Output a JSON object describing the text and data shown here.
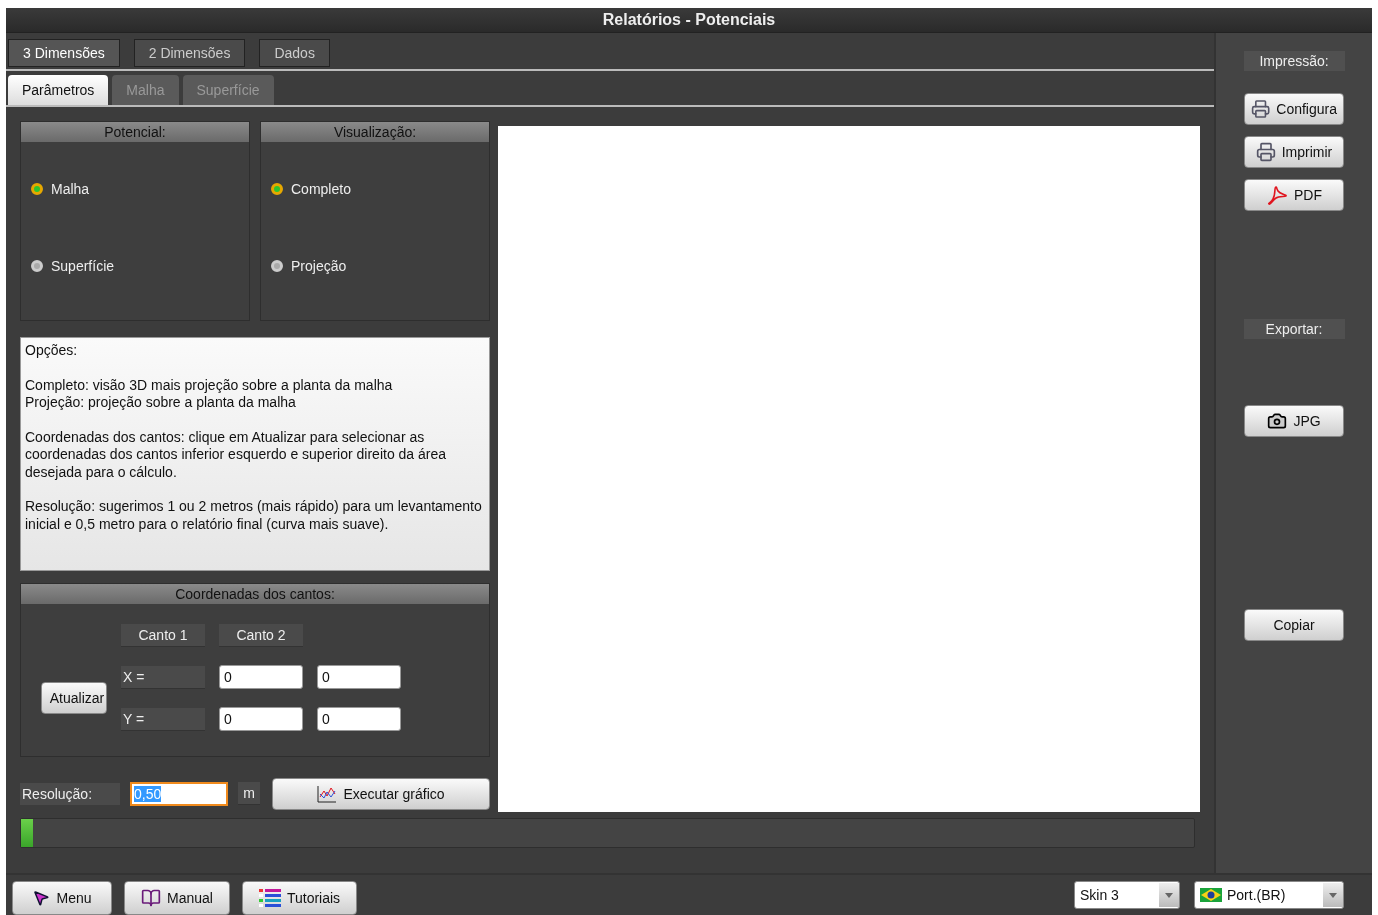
{
  "window": {
    "title": "Relatórios - Potenciais"
  },
  "main_tabs": [
    {
      "label": "3 Dimensões",
      "selected": true
    },
    {
      "label": "2 Dimensões",
      "selected": false
    },
    {
      "label": "Dados",
      "selected": false
    }
  ],
  "sub_tabs": [
    {
      "label": "Parâmetros",
      "selected": true
    },
    {
      "label": "Malha",
      "selected": false
    },
    {
      "label": "Superfície",
      "selected": false
    }
  ],
  "groups": [
    {
      "title": "Potencial:",
      "options": [
        {
          "label": "Malha",
          "selected": true
        },
        {
          "label": "Superfície",
          "selected": false
        }
      ]
    },
    {
      "title": "Visualização:",
      "options": [
        {
          "label": "Completo",
          "selected": true
        },
        {
          "label": "Projeção",
          "selected": false
        }
      ]
    }
  ],
  "options_panel": {
    "paragraphs": [
      [
        "Opções:"
      ],
      [
        "Completo: visão 3D mais projeção sobre a planta da malha",
        "Projeção: projeção sobre a planta da malha"
      ],
      [
        "Coordenadas dos cantos: clique em Atualizar para selecionar as coordenadas dos cantos inferior esquerdo e superior direito da área desejada para o cálculo."
      ],
      [
        "Resolução: sugerimos 1 ou 2 metros (mais rápido) para um levantamento inicial e 0,5 metro para o relatório final (curva mais suave)."
      ]
    ]
  },
  "corners": {
    "title": "Coordenadas dos cantos:",
    "columns": [
      "Canto 1",
      "Canto 2"
    ],
    "rows": [
      {
        "label": "X =",
        "values": [
          "0",
          "0"
        ]
      },
      {
        "label": "Y =",
        "values": [
          "0",
          "0"
        ]
      }
    ],
    "refresh_button": "Atualizar"
  },
  "resolution": {
    "label": "Resolução:",
    "value": "0,50",
    "focused": true,
    "unit": "m"
  },
  "run_button": "Executar gráfico",
  "progress": {
    "level": 0.01
  },
  "sidebar": {
    "print_label": "Impressão:",
    "print_buttons": [
      {
        "kind": "setup",
        "label": "Configura"
      },
      {
        "kind": "print",
        "label": "Imprimir"
      },
      {
        "kind": "pdf",
        "label": "PDF"
      }
    ],
    "export_label": "Exportar:",
    "export_buttons": [
      {
        "kind": "jpg",
        "label": "JPG"
      }
    ],
    "copy_button": "Copiar"
  },
  "bottom_bar": {
    "buttons": [
      {
        "kind": "menu",
        "label": "Menu"
      },
      {
        "kind": "manual",
        "label": "Manual"
      },
      {
        "kind": "tutorials",
        "label": "Tutoriais"
      }
    ],
    "skin_select": "Skin 3",
    "language_select": "Port.(BR)"
  }
}
